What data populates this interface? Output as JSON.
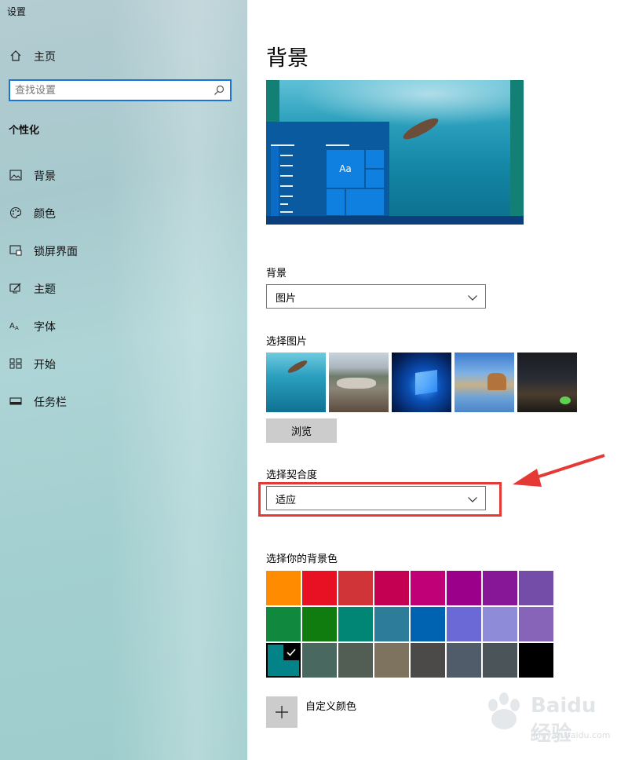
{
  "window": {
    "title": "设置"
  },
  "sidebar": {
    "home_label": "主页",
    "search_placeholder": "查找设置",
    "section_title": "个性化",
    "items": [
      {
        "label": "背景",
        "icon": "picture-icon"
      },
      {
        "label": "颜色",
        "icon": "palette-icon"
      },
      {
        "label": "锁屏界面",
        "icon": "lock-screen-icon"
      },
      {
        "label": "主题",
        "icon": "theme-icon"
      },
      {
        "label": "字体",
        "icon": "font-icon"
      },
      {
        "label": "开始",
        "icon": "start-icon"
      },
      {
        "label": "任务栏",
        "icon": "taskbar-icon"
      }
    ]
  },
  "main": {
    "title": "背景",
    "preview": {
      "tile_text": "Aa"
    },
    "background_label": "背景",
    "background_value": "图片",
    "choose_picture_label": "选择图片",
    "browse_label": "浏览",
    "fit_label": "选择契合度",
    "fit_value": "适应",
    "color_label": "选择你的背景色",
    "colors": [
      [
        "#ff8c00",
        "#e81123",
        "#d13438",
        "#c30052",
        "#bf0077",
        "#9a0089",
        "#881798",
        "#744da9"
      ],
      [
        "#10893e",
        "#107c10",
        "#018574",
        "#2d7d9a",
        "#0063b1",
        "#6b69d6",
        "#8e8cd8",
        "#8764b8"
      ],
      [
        "#038387",
        "#486860",
        "#525e54",
        "#7e735f",
        "#4c4a48",
        "#515c6b",
        "#4a5459",
        "#000000"
      ]
    ],
    "selected_color": "#038387",
    "custom_color_label": "自定义颜色"
  },
  "watermark": {
    "text": "Baidu经验",
    "sub": "jingyan.baidu.com"
  },
  "accent_color": "#1976d2",
  "highlight_color": "#e53935"
}
